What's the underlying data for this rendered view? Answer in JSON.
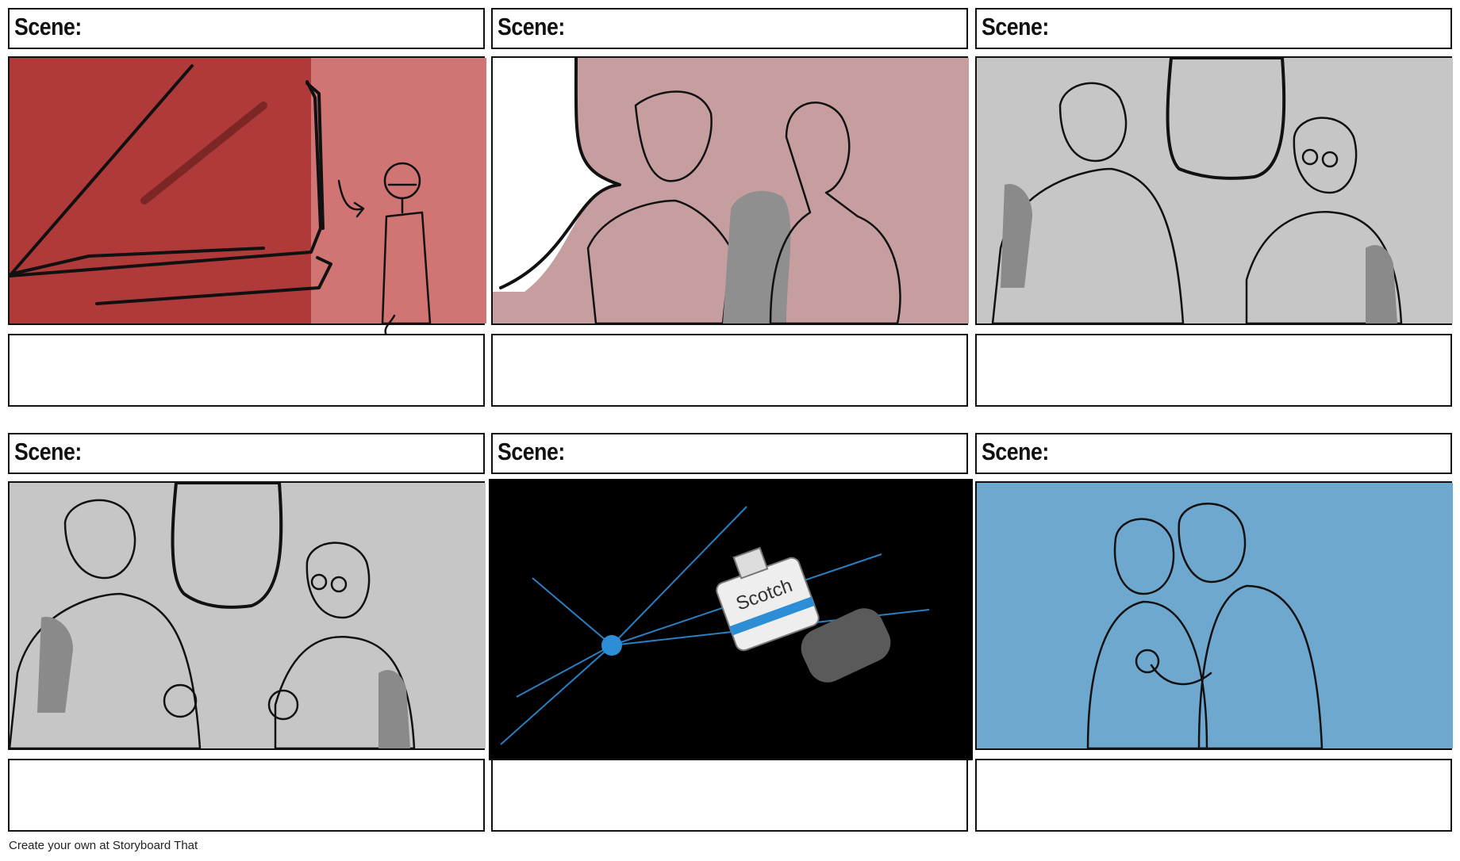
{
  "panels": [
    {
      "scene_label": "Scene:",
      "caption": "",
      "bg": "#b03a3a",
      "bg2": "#d17474"
    },
    {
      "scene_label": "Scene:",
      "caption": "",
      "bg": "#c79ea0"
    },
    {
      "scene_label": "Scene:",
      "caption": "",
      "bg": "#c6c6c6"
    },
    {
      "scene_label": "Scene:",
      "caption": "",
      "bg": "#c6c6c6"
    },
    {
      "scene_label": "Scene:",
      "caption": "",
      "bg": "#000000",
      "accent": "#2d8ed8",
      "bottle_label": "Scotch"
    },
    {
      "scene_label": "Scene:",
      "caption": "",
      "bg": "#6fa8cf"
    }
  ],
  "footer": {
    "credit": "Create your own at Storyboard That"
  }
}
